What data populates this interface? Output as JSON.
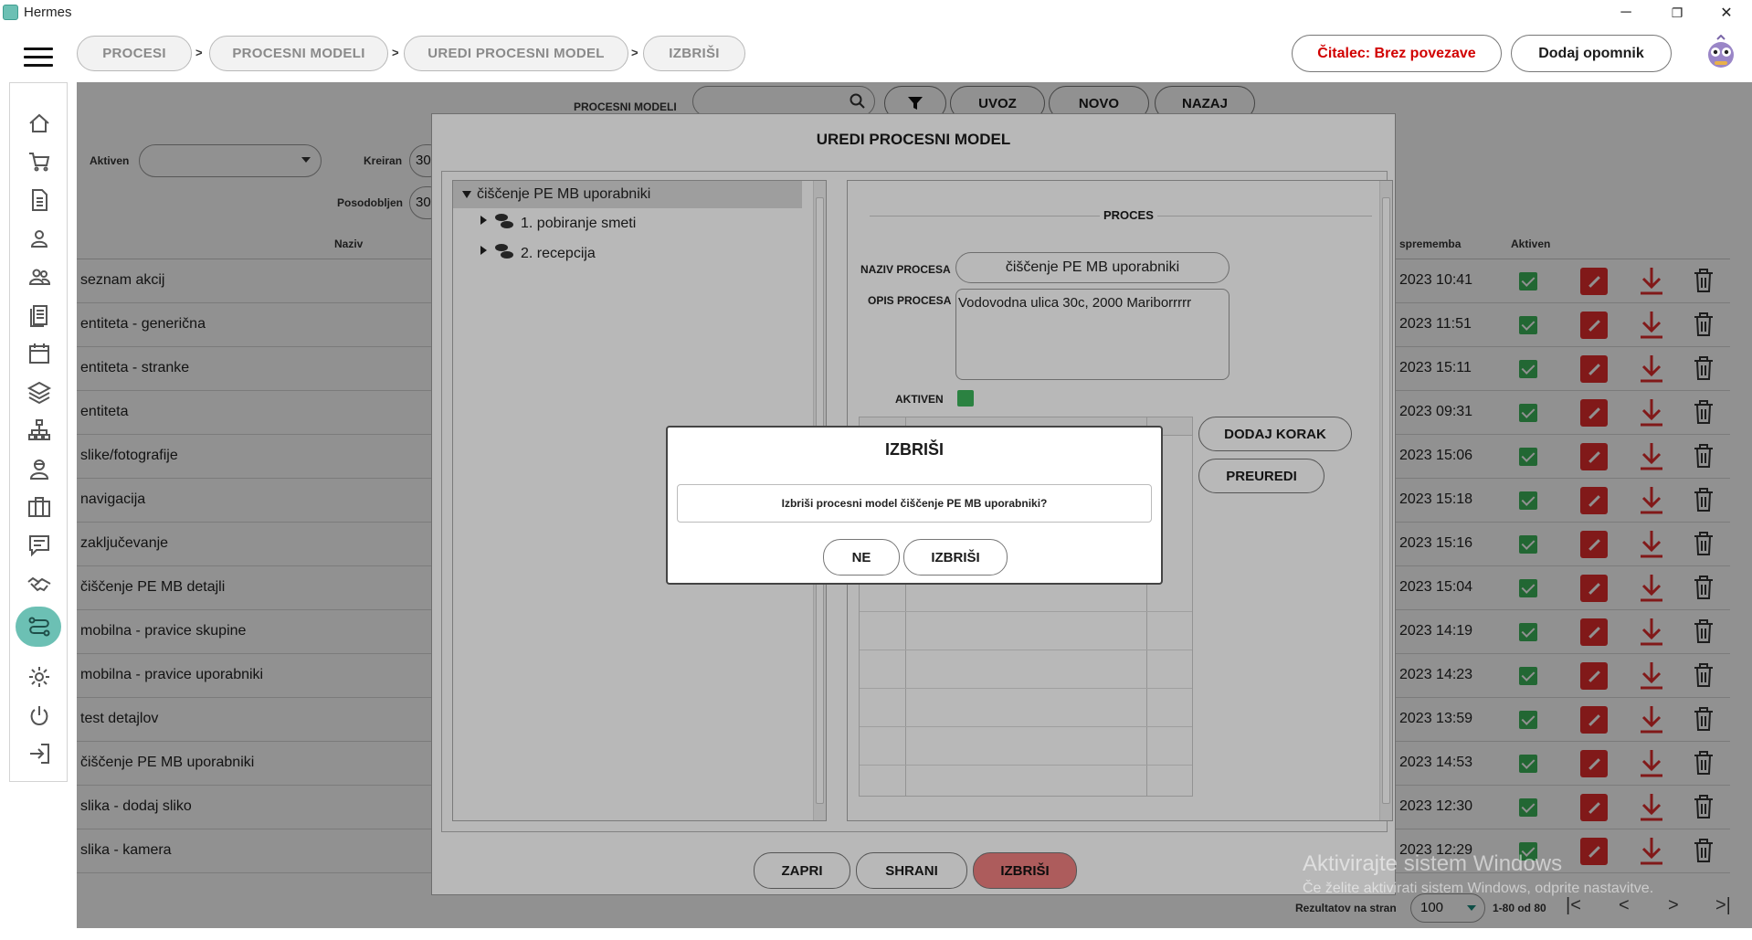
{
  "window": {
    "title": "Hermes",
    "minimize": "─",
    "restore": "❐",
    "close": "✕"
  },
  "breadcrumbs": [
    "PROCESI",
    "PROCESNI MODELI",
    "UREDI PROCESNI MODEL",
    "IZBRIŠI"
  ],
  "crumb_sep": ">",
  "topbar": {
    "reader_status": "Čitalec: Brez povezave",
    "reader_color": "#d10000",
    "reminder_label": "Dodaj opomnik"
  },
  "toolbar": {
    "search_label": "PROCESNI MODELI",
    "import_label": "UVOZ",
    "new_label": "NOVO",
    "back_label": "NAZAJ"
  },
  "filters": {
    "active_label": "Aktiven",
    "created_label": "Kreiran",
    "created_value": "30",
    "updated_label": "Posodobljen",
    "updated_value": "30"
  },
  "table": {
    "headers": {
      "name": "Naziv",
      "modified": "sprememba",
      "active": "Aktiven"
    },
    "rows": [
      {
        "name": "seznam akcij",
        "date": "2023 10:41"
      },
      {
        "name": "entiteta - generična",
        "date": "2023 11:51"
      },
      {
        "name": "entiteta - stranke",
        "date": "2023 15:11"
      },
      {
        "name": "entiteta",
        "date": "2023 09:31"
      },
      {
        "name": "slike/fotografije",
        "date": "2023 15:06"
      },
      {
        "name": "navigacija",
        "date": "2023 15:18"
      },
      {
        "name": "zaključevanje",
        "date": "2023 15:16"
      },
      {
        "name": "čiščenje PE MB detajli",
        "date": "2023 15:04"
      },
      {
        "name": "mobilna - pravice skupine",
        "date": "2023 14:19"
      },
      {
        "name": "mobilna - pravice uporabniki",
        "date": "2023 14:23"
      },
      {
        "name": "test detajlov",
        "date": "2023 13:59"
      },
      {
        "name": "čiščenje PE MB uporabniki",
        "date": "2023 14:53"
      },
      {
        "name": "slika - dodaj sliko",
        "date": "2023 12:30"
      },
      {
        "name": "slika - kamera",
        "date": "2023 12:29"
      }
    ]
  },
  "pagination": {
    "per_page_label": "Rezultatov na stran",
    "per_page_value": "100",
    "range": "1-80 od 80"
  },
  "edit_dialog": {
    "title": "UREDI PROCESNI MODEL",
    "tree_root": "čiščenje PE MB uporabniki",
    "tree_children": [
      "1. pobiranje smeti",
      "2. recepcija"
    ],
    "section_title": "PROCES",
    "name_label": "NAZIV PROCESA",
    "name_value": "čiščenje PE MB uporabniki",
    "desc_label": "OPIS PROCESA",
    "desc_value": "Vodovodna ulica 30c, 2000 Mariborrrrr",
    "active_label": "AKTIVEN",
    "add_step_label": "DODAJ KORAK",
    "reorder_label": "PREUREDI",
    "close_label": "ZAPRI",
    "save_label": "SHRANI",
    "delete_label": "IZBRIŠI"
  },
  "confirm_dialog": {
    "title": "IZBRIŠI",
    "message": "Izbriši procesni model čiščenje PE MB uporabniki?",
    "no_label": "NE",
    "yes_label": "IZBRIŠI"
  },
  "watermark": {
    "line1": "Aktivirajte sistem Windows",
    "line2": "Če želite aktivirati sistem Windows, odprite nastavitve."
  },
  "colors": {
    "accent": "#6cc0b4",
    "danger": "#e32c2c",
    "check": "#3cb55a"
  }
}
